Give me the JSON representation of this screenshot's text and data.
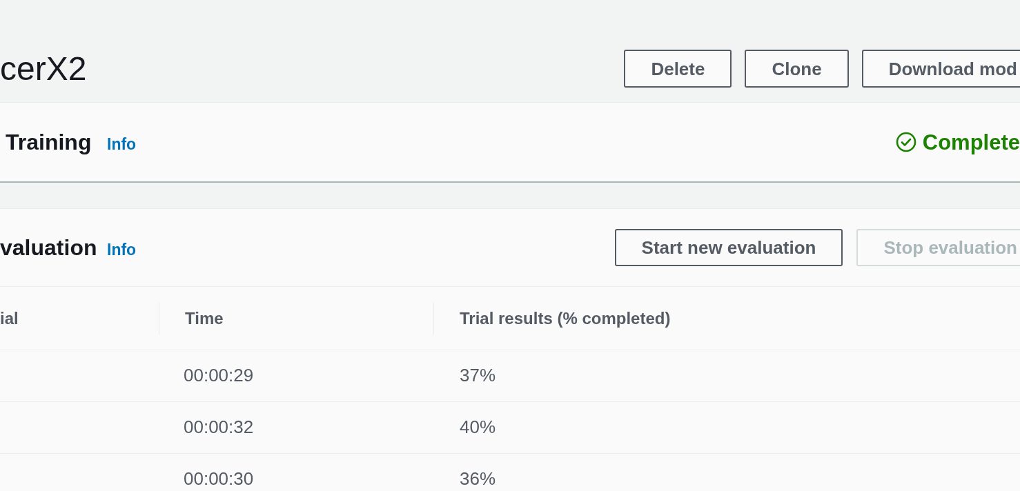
{
  "header": {
    "title": "cerX2",
    "actions": [
      {
        "label": "Delete",
        "disabled": false
      },
      {
        "label": "Clone",
        "disabled": false
      },
      {
        "label": "Download mod",
        "disabled": false
      }
    ]
  },
  "training": {
    "title": "Training",
    "info_link": "Info",
    "status": {
      "kind": "success",
      "label": "Complete"
    }
  },
  "evaluation": {
    "title": "valuation",
    "info_link": "Info",
    "actions": [
      {
        "label": "Start new evaluation",
        "disabled": false
      },
      {
        "label": "Stop evaluation",
        "disabled": true
      }
    ],
    "table": {
      "columns": [
        "ial",
        "Time",
        "Trial results (% completed)"
      ],
      "rows": [
        {
          "time": "00:00:29",
          "trial_result": "37%"
        },
        {
          "time": "00:00:32",
          "trial_result": "40%"
        },
        {
          "time": "00:00:30",
          "trial_result": "36%"
        }
      ]
    }
  }
}
